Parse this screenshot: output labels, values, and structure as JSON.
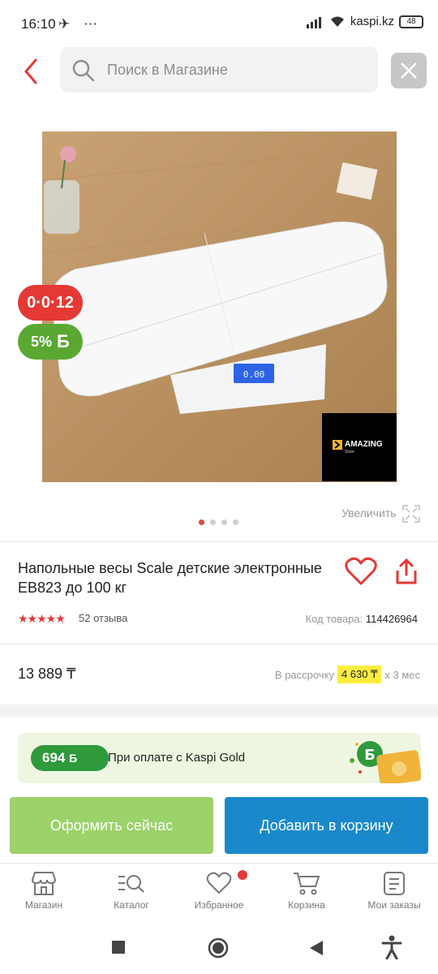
{
  "status_bar": {
    "time": "16:10",
    "indicators": "✈ ⋯",
    "domain": "kaspi.kz",
    "battery": "48"
  },
  "header": {
    "search_placeholder": "Поиск в Магазине",
    "back_icon": "chevron-left-icon",
    "close_icon": "close-icon"
  },
  "gallery": {
    "installment_badge": "0·0·12",
    "bonus_badge_percent": "5%",
    "bonus_symbol": "Б",
    "brand_line1": "AMAZING",
    "brand_line2": "Store",
    "scale_display": "0.00",
    "current_image": 1,
    "image_count": 4,
    "zoom_label": "Увеличить"
  },
  "product": {
    "title": "Напольные весы Scale детские электронные EB823 до 100 кг",
    "rating": 4.5,
    "reviews": "52 отзыва",
    "code_label": "Код товара:",
    "code_value": "114426964",
    "price": "13 889 ₸",
    "installment_prefix": "В рассрочку",
    "installment_amount": "4 630 ₸",
    "installment_suffix": "x 3 мес"
  },
  "kaspi_gold": {
    "bonus": "694",
    "bonus_symbol": "Б",
    "text": "При оплате с Kaspi Gold"
  },
  "actions": {
    "checkout": "Оформить сейчас",
    "add_to_cart": "Добавить в корзину"
  },
  "bottom_nav": [
    {
      "label": "Магазин",
      "icon": "shop-icon"
    },
    {
      "label": "Каталог",
      "icon": "catalog-icon"
    },
    {
      "label": "Избранное",
      "icon": "heart-icon"
    },
    {
      "label": "Корзина",
      "icon": "cart-icon"
    },
    {
      "label": "Мои заказы",
      "icon": "orders-icon"
    }
  ],
  "colors": {
    "accent_red": "#e53935",
    "green_button": "#9bd26a",
    "blue_button": "#1a89cc",
    "bonus_green": "#5aa832",
    "highlight_yellow": "#ffec3f"
  }
}
